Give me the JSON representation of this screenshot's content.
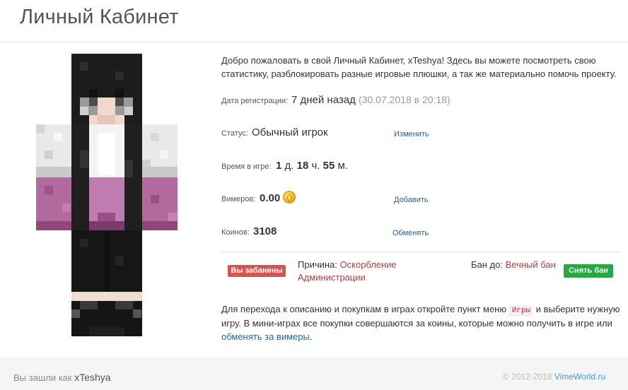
{
  "page": {
    "title": "Личный Кабинет"
  },
  "welcome": "Добро пожаловать в свой Личный Кабинет, xTeshya! Здесь вы можете посмотреть свою статистику, разблокировать разные игровые плюшки, а так же материально помочь проекту.",
  "stats": {
    "registration": {
      "label": "Дата регистрации:",
      "value": "7 дней назад",
      "exact": "(30.07.2018 в 20:18)"
    },
    "status": {
      "label": "Статус:",
      "value": "Обычный игрок",
      "action": "Изменить"
    },
    "playtime": {
      "label": "Время в игре:",
      "days": "1",
      "days_unit": "д.",
      "hours": "18",
      "hours_unit": "ч.",
      "minutes": "55",
      "minutes_unit": "м."
    },
    "vimers": {
      "label": "Вимеров:",
      "value": "0.00",
      "action": "Добавить",
      "icon": "gold-coin-icon"
    },
    "coins": {
      "label": "Коинов:",
      "value": "3108",
      "action": "Обменять"
    }
  },
  "ban": {
    "badge": "Вы забанены",
    "reason_label": "Причина:",
    "reason_value": "Оскорбление Администрации",
    "until_label": "Бан до:",
    "until_value": "Вечный бан",
    "unban_button": "Снять бан"
  },
  "help": {
    "part1": "Для перехода к описанию и покупкам в играх откройте пункт меню",
    "menu_item": "Игры",
    "part2": "и выберите нужную игру. В мини-играх все покупки совершаются за коины, которые можно получить в игре или",
    "link": "обменять за вимеры",
    "end": "."
  },
  "footer": {
    "logged_in_as": "Вы зашли как",
    "username": "xTeshya",
    "copyright": "© 2012-2018",
    "site": "VimeWorld.ru"
  },
  "colors": {
    "danger": "#d9534f",
    "success": "#28a745",
    "link": "#2a5d9f",
    "skin_purple": "#b5649f"
  }
}
